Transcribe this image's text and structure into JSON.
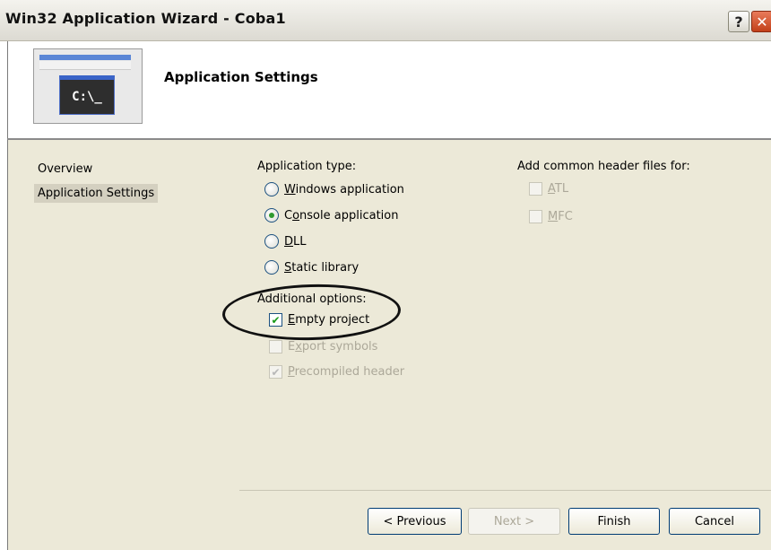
{
  "window": {
    "title": "Win32 Application Wizard - Coba1",
    "help_glyph": "?",
    "close_glyph": "✕"
  },
  "header": {
    "title": "Application Settings",
    "console_text": "C:\\_"
  },
  "nav": {
    "items": [
      {
        "label": "Overview"
      },
      {
        "label": "Application Settings"
      }
    ]
  },
  "app_type": {
    "label": "Application type:",
    "options": [
      {
        "mnemonic": "W",
        "rest": "indows application",
        "checked": false
      },
      {
        "pre": "C",
        "mnemonic": "o",
        "rest": "nsole application",
        "checked": true
      },
      {
        "mnemonic": "D",
        "rest": "LL",
        "checked": false
      },
      {
        "mnemonic": "S",
        "rest": "tatic library",
        "checked": false
      }
    ]
  },
  "additional": {
    "label": "Additional options:",
    "options": [
      {
        "mnemonic": "E",
        "rest": "mpty project",
        "checked": true,
        "enabled": true
      },
      {
        "mnemonic": "x",
        "pre": "E",
        "rest": "port symbols",
        "checked": false,
        "enabled": false
      },
      {
        "mnemonic": "P",
        "rest": "recompiled header",
        "checked": true,
        "enabled": false
      }
    ]
  },
  "headers": {
    "label": "Add common header files for:",
    "options": [
      {
        "mnemonic": "A",
        "rest": "TL",
        "checked": false,
        "enabled": false
      },
      {
        "mnemonic": "M",
        "rest": "FC",
        "checked": false,
        "enabled": false
      }
    ]
  },
  "buttons": {
    "previous": "< Previous",
    "next": "Next >",
    "finish": "Finish",
    "cancel": "Cancel"
  },
  "colors": {
    "panel_bg": "#ece9d8",
    "radio_dot": "#2e9a2e",
    "check_mark": "#1a9a1a"
  }
}
